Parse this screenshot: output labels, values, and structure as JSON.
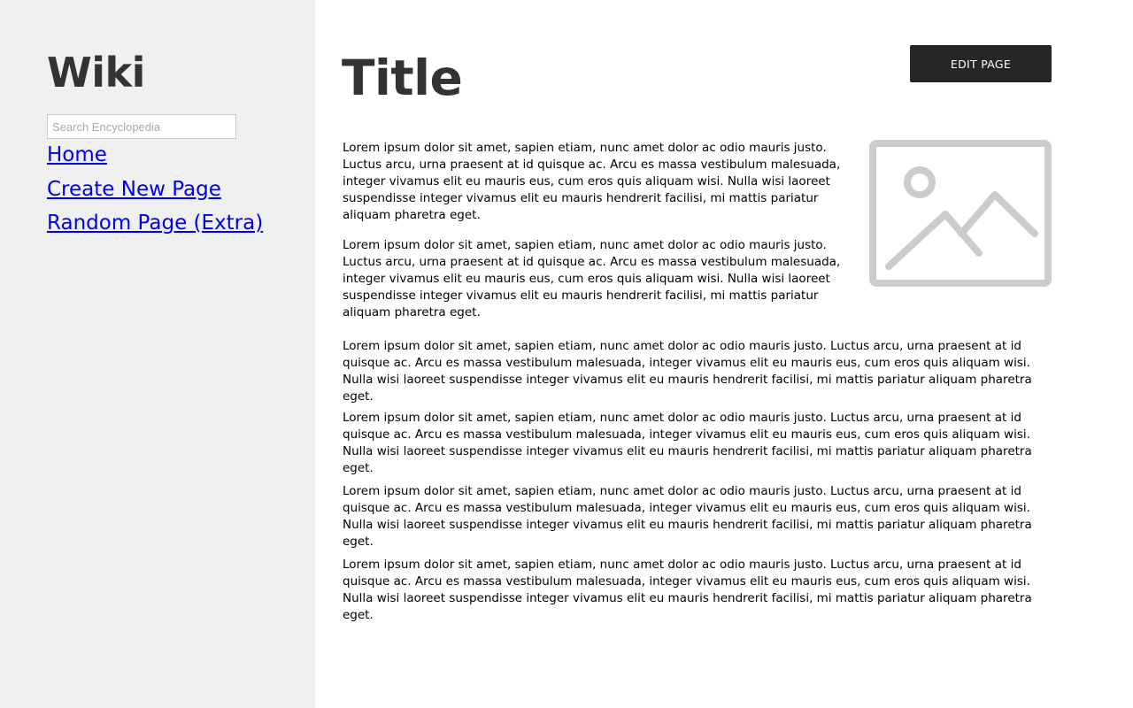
{
  "sidebar": {
    "brand": "Wiki",
    "search_placeholder": "Search Encyclopedia",
    "search_value": "",
    "nav": [
      {
        "label": "Home"
      },
      {
        "label": "Create New Page"
      },
      {
        "label": "Random Page (Extra)"
      }
    ]
  },
  "main": {
    "title": "Title",
    "edit_button": "EDIT PAGE",
    "image_icon": "image-placeholder-icon",
    "paragraphs": [
      "Lorem ipsum dolor sit amet, sapien etiam, nunc amet dolor ac odio mauris justo. Luctus arcu, urna praesent at id quisque ac. Arcu es massa vestibulum malesuada, integer vivamus elit eu mauris eus, cum eros quis aliquam wisi. Nulla wisi laoreet suspendisse integer vivamus elit eu mauris hendrerit facilisi, mi mattis pariatur aliquam pharetra eget.",
      "Lorem ipsum dolor sit amet, sapien etiam, nunc amet dolor ac odio mauris justo. Luctus arcu, urna praesent at id quisque ac. Arcu es massa vestibulum malesuada, integer vivamus elit eu mauris eus, cum eros quis aliquam wisi. Nulla wisi laoreet suspendisse integer vivamus elit eu mauris hendrerit facilisi, mi mattis pariatur aliquam pharetra eget.",
      "Lorem ipsum dolor sit amet, sapien etiam, nunc amet dolor ac odio mauris justo. Luctus arcu, urna praesent at id quisque ac. Arcu es massa vestibulum malesuada, integer vivamus elit eu mauris eus, cum eros quis aliquam wisi. Nulla wisi laoreet suspendisse integer vivamus elit eu mauris hendrerit facilisi, mi mattis pariatur aliquam pharetra eget.",
      "Lorem ipsum dolor sit amet, sapien etiam, nunc amet dolor ac odio mauris justo. Luctus arcu, urna praesent at id quisque ac. Arcu es massa vestibulum malesuada, integer vivamus elit eu mauris eus, cum eros quis aliquam wisi. Nulla wisi laoreet suspendisse integer vivamus elit eu mauris hendrerit facilisi, mi mattis pariatur aliquam pharetra eget.",
      "Lorem ipsum dolor sit amet, sapien etiam, nunc amet dolor ac odio mauris justo. Luctus arcu, urna praesent at id quisque ac. Arcu es massa vestibulum malesuada, integer vivamus elit eu mauris eus, cum eros quis aliquam wisi. Nulla wisi laoreet suspendisse integer vivamus elit eu mauris hendrerit facilisi, mi mattis pariatur aliquam pharetra eget.",
      "Lorem ipsum dolor sit amet, sapien etiam, nunc amet dolor ac odio mauris justo. Luctus arcu, urna praesent at id quisque ac. Arcu es massa vestibulum malesuada, integer vivamus elit eu mauris eus, cum eros quis aliquam wisi. Nulla wisi laoreet suspendisse integer vivamus elit eu mauris hendrerit facilisi, mi mattis pariatur aliquam pharetra eget."
    ]
  },
  "colors": {
    "sidebar_bg": "#f0f0f0",
    "heading_text": "#333333",
    "link": "#0000ee",
    "button_bg": "#262626",
    "button_text": "#ffffff",
    "image_placeholder": "#cccccc"
  }
}
